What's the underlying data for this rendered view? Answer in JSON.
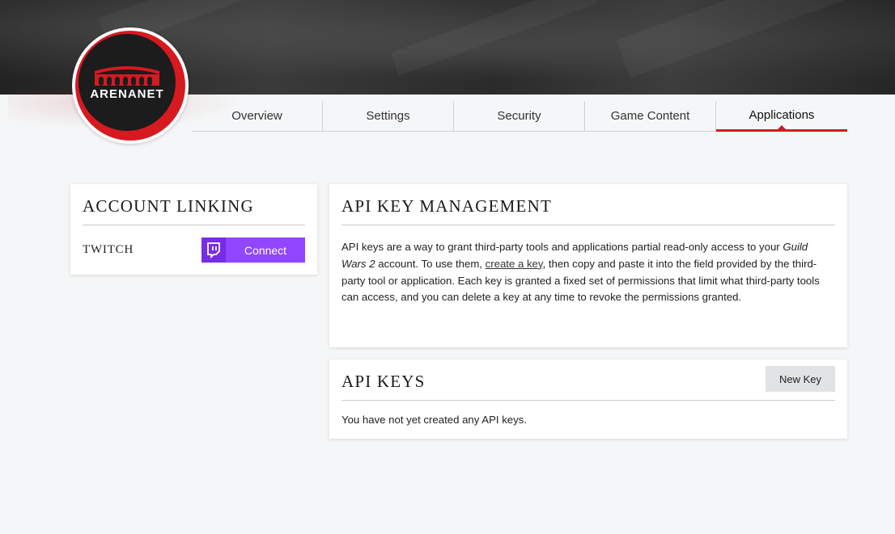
{
  "brand": {
    "logo_text": "ARENANET",
    "accent_color": "#d71920",
    "twitch_color": "#9146ff"
  },
  "nav": {
    "tabs": [
      {
        "label": "Overview"
      },
      {
        "label": "Settings"
      },
      {
        "label": "Security"
      },
      {
        "label": "Game Content"
      },
      {
        "label": "Applications",
        "active": true
      }
    ]
  },
  "account_linking": {
    "title": "ACCOUNT LINKING",
    "service_label": "TWITCH",
    "connect_label": "Connect",
    "icon": "twitch-icon"
  },
  "api_management": {
    "title": "API KEY MANAGEMENT",
    "desc_1": "API keys are a way to grant third-party tools and applications partial read-only access to your ",
    "game_name": "Guild Wars 2",
    "desc_2": " account. To use them, ",
    "link_label": "create a key",
    "desc_3": ", then copy and paste it into the field provided by the third-party tool or application. Each key is granted a fixed set of permissions that limit what third-party tools can access, and you can delete a key at any time to revoke the permissions granted."
  },
  "api_keys": {
    "title": "API KEYS",
    "new_key_label": "New Key",
    "empty_message": "You have not yet created any API keys."
  }
}
